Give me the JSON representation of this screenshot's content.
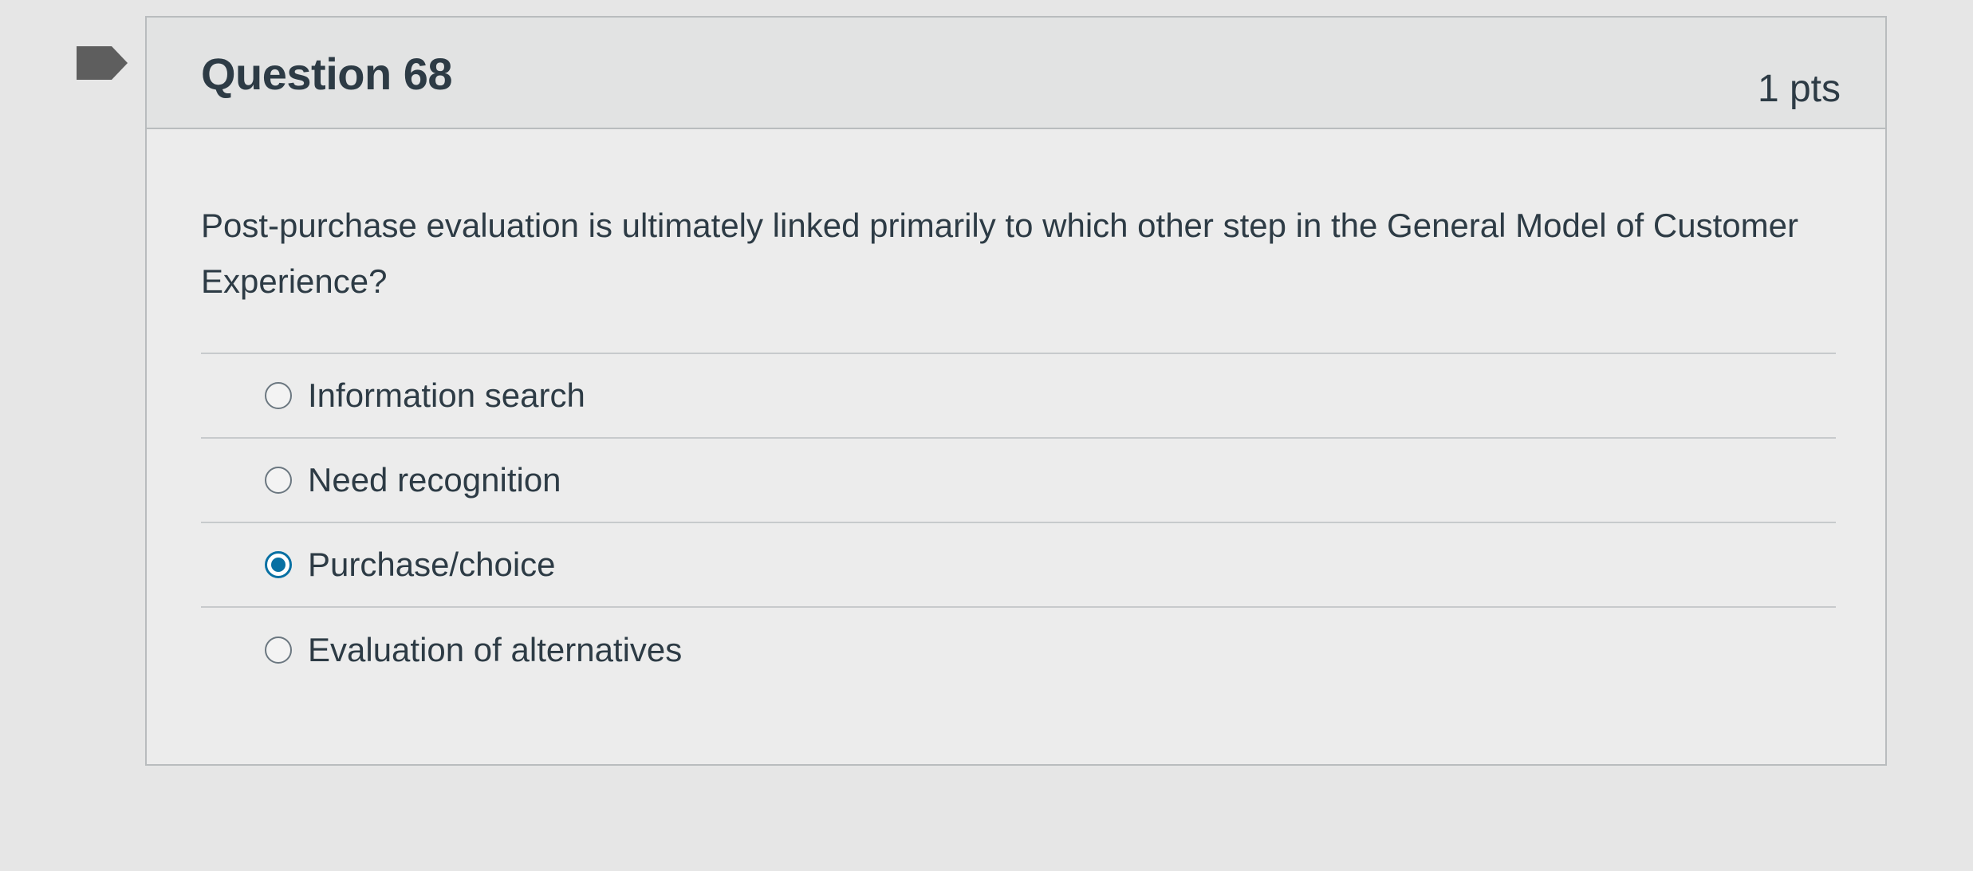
{
  "question": {
    "title": "Question 68",
    "points": "1 pts",
    "text": "Post-purchase evaluation is ultimately linked primarily to which other step in the General Model of Customer Experience?",
    "flag_icon": "flag-marker-icon",
    "answers": [
      {
        "label": "Information search",
        "selected": false
      },
      {
        "label": "Need recognition",
        "selected": false
      },
      {
        "label": "Purchase/choice",
        "selected": true
      },
      {
        "label": "Evaluation of alternatives",
        "selected": false
      }
    ]
  },
  "colors": {
    "selected_radio": "#0770a3",
    "flag_marker": "#5e5e5e",
    "page_background": "#e6e6e6"
  }
}
